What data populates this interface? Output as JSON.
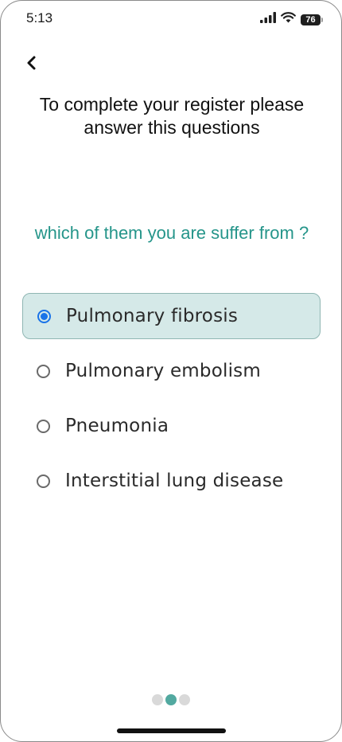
{
  "status_bar": {
    "time": "5:13",
    "battery": "76"
  },
  "icons": {
    "back": "chevron-left-icon",
    "signal": "cellular-signal-icon",
    "wifi": "wifi-icon",
    "battery": "battery-icon"
  },
  "header": {
    "title": "To complete your register please answer this questions"
  },
  "question": {
    "text": "which of them you are suffer from ?"
  },
  "options": [
    {
      "label": "Pulmonary fibrosis",
      "selected": true
    },
    {
      "label": "Pulmonary embolism",
      "selected": false
    },
    {
      "label": "Pneumonia",
      "selected": false
    },
    {
      "label": "Interstitial lung disease",
      "selected": false
    }
  ],
  "pager": {
    "total": 3,
    "current": 2
  },
  "colors": {
    "accent": "#25958a",
    "selected_bg": "#d5e9e8",
    "radio_checked": "#1a73e8",
    "pager_active": "#52a9a0",
    "pager_inactive": "#d9d9d9"
  }
}
